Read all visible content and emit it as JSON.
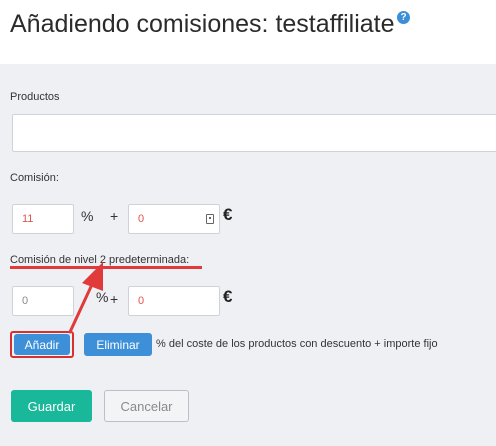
{
  "header": {
    "title": "Añadiendo comisiones: testaffiliate",
    "help_glyph": "?"
  },
  "form": {
    "products_label": "Productos",
    "products_value": "",
    "commission_label": "Comisión:",
    "commission_percent_value": "11",
    "percent_symbol": "%",
    "plus_symbol": "+",
    "commission_fixed_value": "0",
    "currency_symbol": "€",
    "level2_label": "Comisión de nivel 2 predeterminada:",
    "level2_percent_value": "0",
    "level2_fixed_value": "0",
    "add_label": "Añadir",
    "remove_label": "Eliminar",
    "description": "% del coste de los productos con descuento + importe fijo",
    "save_label": "Guardar",
    "cancel_label": "Cancelar"
  },
  "colors": {
    "accent_blue": "#3d8fd8",
    "save_green": "#1ab89a",
    "annotation_red": "#e03a3a",
    "value_red": "#e0554a"
  },
  "icons": [
    "help-icon",
    "calculator-icon",
    "annotation-arrow"
  ]
}
